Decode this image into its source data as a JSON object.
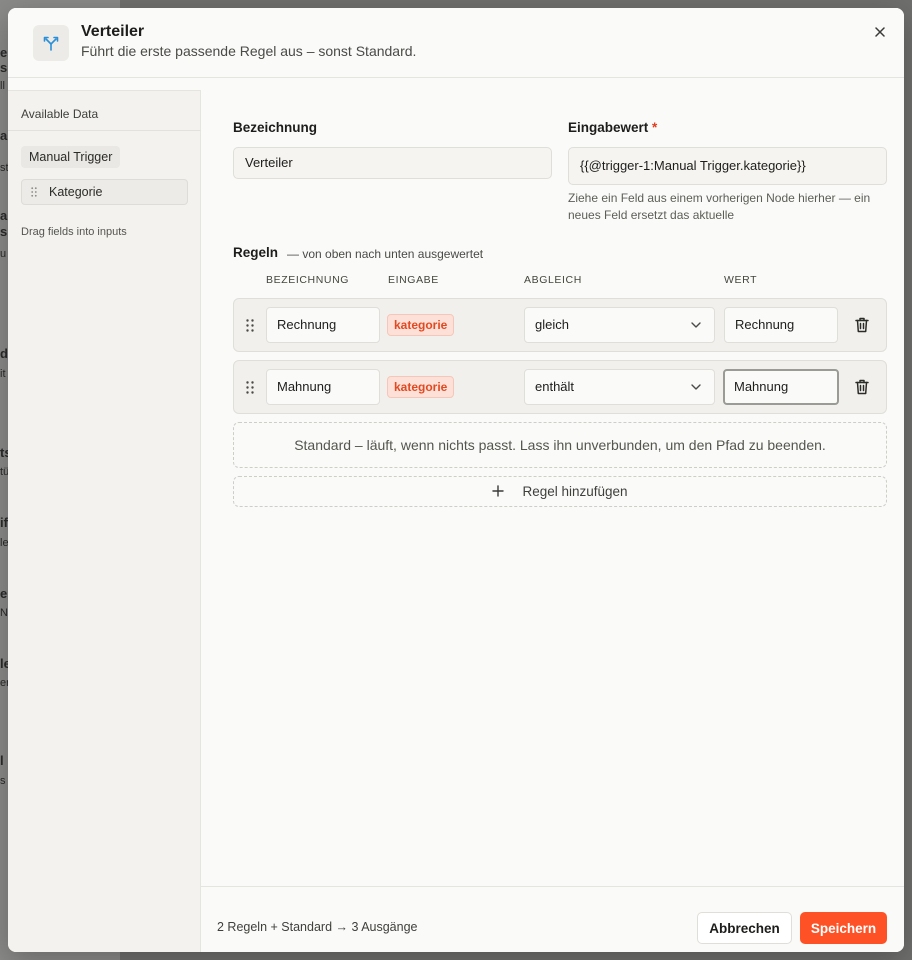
{
  "background": {
    "fragments": [
      "e",
      "s",
      "ll",
      "a",
      "st",
      "a",
      "s",
      "u",
      "d",
      "it",
      "ts",
      "tü",
      "if",
      "le",
      "er",
      "N",
      "le",
      "er",
      "l",
      "s"
    ]
  },
  "header": {
    "title": "Verteiler",
    "subtitle": "Führt die erste passende Regel aus – sonst Standard.",
    "icon": "split-branch-icon",
    "accent_color": "#2a8fd8"
  },
  "sidebar": {
    "title": "Available Data",
    "source": "Manual Trigger",
    "field": "Kategorie",
    "hint": "Drag fields into inputs"
  },
  "form": {
    "name_label": "Bezeichnung",
    "name_value": "Verteiler",
    "input_label": "Eingabewert",
    "required_mark": "*",
    "input_value": "{{@trigger-1:Manual Trigger.kategorie}}",
    "input_hint": "Ziehe ein Feld aus einem vorherigen Node hierher — ein neues Feld ersetzt das aktuelle"
  },
  "rules": {
    "title": "Regeln",
    "subtitle": "— von oben nach unten ausgewertet",
    "columns": [
      "BEZEICHNUNG",
      "EINGABE",
      "ABGLEICH",
      "WERT"
    ],
    "rows": [
      {
        "name": "Rechnung",
        "input_tag": "kategorie",
        "match": "gleich",
        "value": "Rechnung"
      },
      {
        "name": "Mahnung",
        "input_tag": "kategorie",
        "match": "enthält",
        "value": "Mahnung"
      }
    ],
    "default_text": "Standard – läuft, wenn nichts passt. Lass ihn unverbunden, um den Pfad zu beenden.",
    "add_label": "Regel hinzufügen"
  },
  "footer": {
    "summary": "2 Regeln + Standard → 3 Ausgänge",
    "cancel_label": "Abbrechen",
    "save_label": "Speichern",
    "save_color": "#ff5126"
  }
}
